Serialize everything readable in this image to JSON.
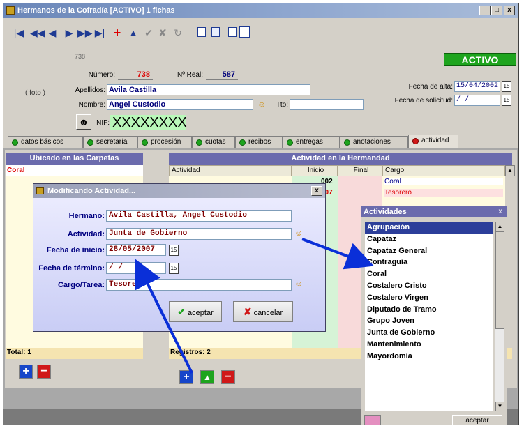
{
  "window": {
    "title": "Hermanos de la Cofradía [ACTIVO] 1 fichas",
    "min": "_",
    "max": "□",
    "close": "x"
  },
  "toolbar": {
    "first": "|◀",
    "prev_page": "◀◀",
    "prev": "◀",
    "next": "▶",
    "next_page": "▶▶",
    "last": "▶|",
    "add": "+",
    "up": "▲",
    "check": "✔",
    "cancel": "✘",
    "refresh": "↻"
  },
  "record": {
    "photo": "( foto )",
    "small_id": "738",
    "status": "ACTIVO",
    "numero_label": "Número:",
    "numero": "738",
    "nreal_label": "Nº Real:",
    "nreal": "587",
    "apellidos_label": "Apellidos:",
    "apellidos": "Avila Castilla",
    "nombre_label": "Nombre:",
    "nombre": "Angel Custodio",
    "tto_label": "Tto:",
    "tto": "",
    "nif_label": "NIF:",
    "nif": "XXXXXXXX",
    "alta_label": "Fecha de alta:",
    "alta": "15/04/2002",
    "solicitud_label": "Fecha de solicitud:",
    "solicitud": " / /"
  },
  "tabs": [
    "datos básicos",
    "secretaría",
    "procesión",
    "cuotas",
    "recibos",
    "entregas",
    "anotaciones",
    "actividad"
  ],
  "left_panel": {
    "title": "Ubicado en las Carpetas",
    "item": "Coral",
    "total": "Total: 1"
  },
  "right_panel": {
    "title": "Actividad en la Hermandad",
    "cols": [
      "Actividad",
      "Inicio",
      "Final",
      "Cargo"
    ],
    "rows": [
      {
        "inicio": "002",
        "cargo": "Coral"
      },
      {
        "inicio": "007",
        "cargo": "Tesorero"
      }
    ],
    "total": "Registros: 2"
  },
  "dialog": {
    "title": "Modificando Actividad...",
    "close": "x",
    "hermano_label": "Hermano:",
    "hermano": "Avila Castilla, Angel Custodio",
    "actividad_label": "Actividad:",
    "actividad": "Junta de Gobierno",
    "inicio_label": "Fecha de inicio:",
    "inicio": "28/05/2007",
    "termino_label": "Fecha de término:",
    "termino": " / /",
    "cargo_label": "Cargo/Tarea:",
    "cargo": "Tesorero",
    "accept": "aceptar",
    "cancel": "cancelar"
  },
  "popup": {
    "title": "Actividades",
    "close": "x",
    "accept": "aceptar",
    "items": [
      "Agrupación",
      "Capataz",
      "Capataz General",
      "Contraguía",
      "Coral",
      "Costalero Cristo",
      "Costalero Virgen",
      "Diputado de Tramo",
      "Grupo Joven",
      "Junta de Gobierno",
      "Mantenimiento",
      "Mayordomía"
    ]
  },
  "colors": {
    "accent": "#0a2fd8",
    "active": "#1ea41e",
    "header": "#6b6bad"
  }
}
